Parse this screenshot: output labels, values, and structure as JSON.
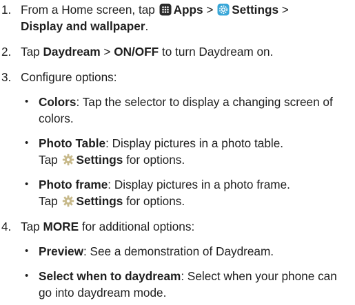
{
  "steps": [
    {
      "number": "1.",
      "parts": {
        "a": "From a Home screen, tap ",
        "apps": "Apps",
        "sep1": " > ",
        "settings": "Settings",
        "sep2": " >",
        "display": "Display and wallpaper",
        "end": "."
      }
    },
    {
      "number": "2.",
      "parts": {
        "a": "Tap ",
        "daydream": "Daydream",
        "sep": " > ",
        "onoff": "ON/OFF",
        "end": " to turn Daydream on."
      }
    },
    {
      "number": "3.",
      "text": "Configure options:",
      "bullets": [
        {
          "term": "Colors",
          "desc": ": Tap the selector to display a changing screen of colors."
        },
        {
          "term": "Photo Table",
          "desc": ": Display pictures in a photo table.",
          "tap": "Tap ",
          "settings": "Settings",
          "end": " for options."
        },
        {
          "term": "Photo frame",
          "desc": ": Display pictures in a photo frame.",
          "tap": "Tap ",
          "settings": "Settings",
          "end": " for options."
        }
      ]
    },
    {
      "number": "4.",
      "parts": {
        "a": "Tap ",
        "more": "MORE",
        "end": " for additional options:"
      },
      "bullets": [
        {
          "term": "Preview",
          "desc": ": See a demonstration of Daydream."
        },
        {
          "term": "Select when to daydream",
          "desc": ": Select when your phone can go into daydream mode."
        }
      ]
    }
  ],
  "icons": {
    "apps": "apps-grid-icon",
    "settings": "settings-gear-icon",
    "settings_inline": "gear-icon"
  },
  "colors": {
    "text": "#1f1f1f",
    "apps_icon": "#2b2b2b",
    "settings_icon_bg": "#3aa7d8",
    "gear_icon": "#c7b98a"
  }
}
